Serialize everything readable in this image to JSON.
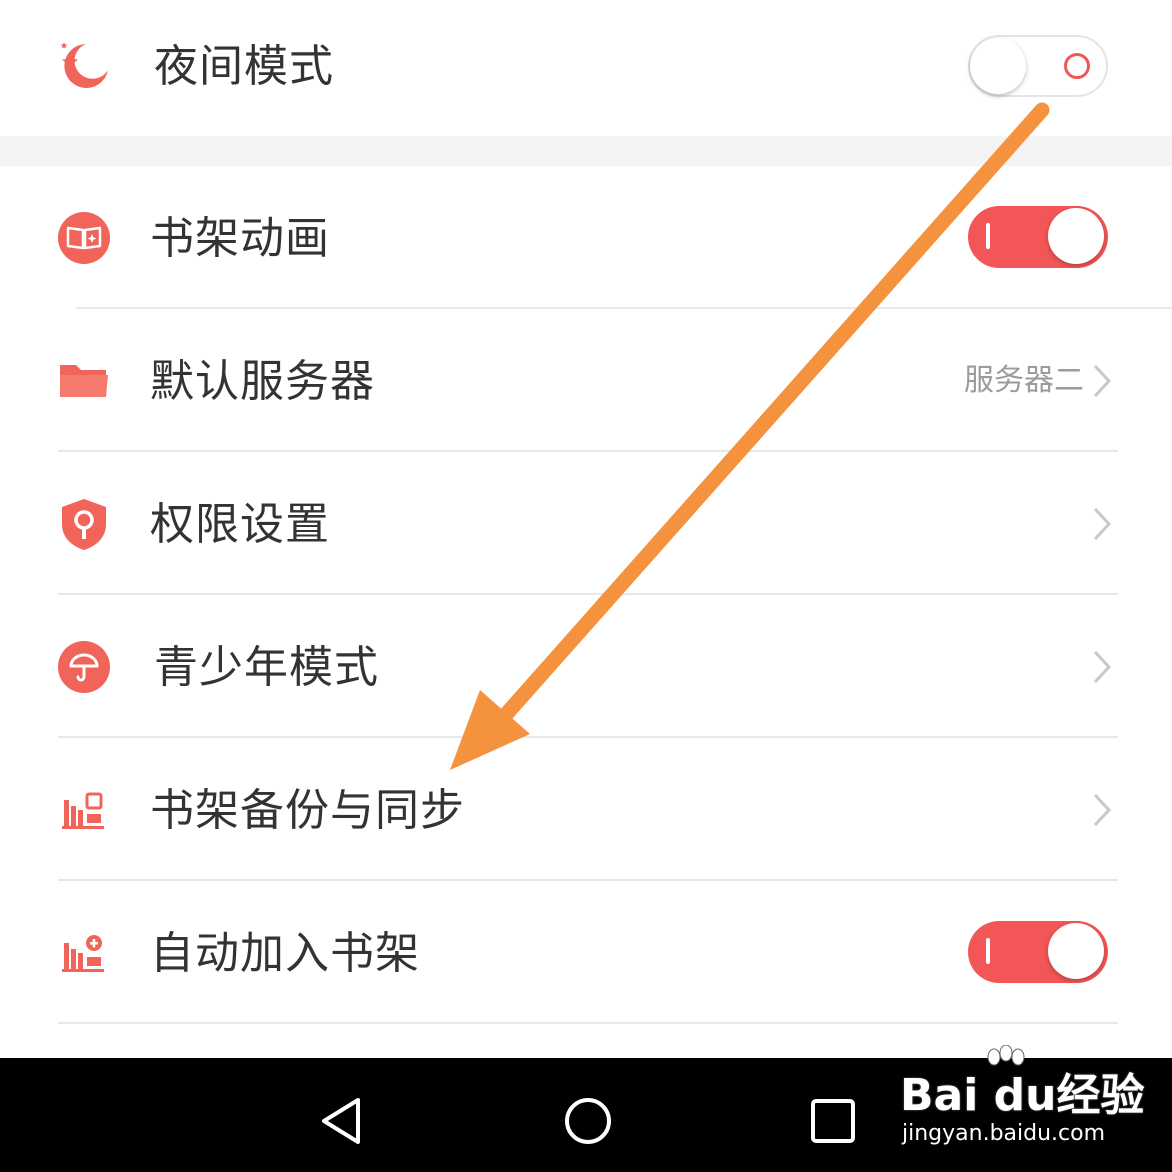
{
  "settings": {
    "night_mode": {
      "label": "夜间模式",
      "icon": "moon-star-icon",
      "enabled": false
    },
    "shelf_animation": {
      "label": "书架动画",
      "icon": "book-sparkle-icon",
      "enabled": true
    },
    "default_server": {
      "label": "默认服务器",
      "icon": "folder-icon",
      "value": "服务器二"
    },
    "permissions": {
      "label": "权限设置",
      "icon": "shield-key-icon"
    },
    "teen_mode": {
      "label": "青少年模式",
      "icon": "umbrella-icon"
    },
    "shelf_backup": {
      "label": "书架备份与同步",
      "icon": "shelf-sync-icon"
    },
    "auto_add_shelf": {
      "label": "自动加入书架",
      "icon": "shelf-add-icon",
      "enabled": true
    }
  },
  "navbar": {
    "back": "back-triangle-icon",
    "home": "home-circle-icon",
    "recents": "recents-square-icon"
  },
  "watermark": {
    "main": "Bai du经验",
    "sub": "jingyan.baidu.com"
  },
  "colors": {
    "accent": "#f25656",
    "icon": "#f0645a",
    "arrow": "#f5923e"
  }
}
